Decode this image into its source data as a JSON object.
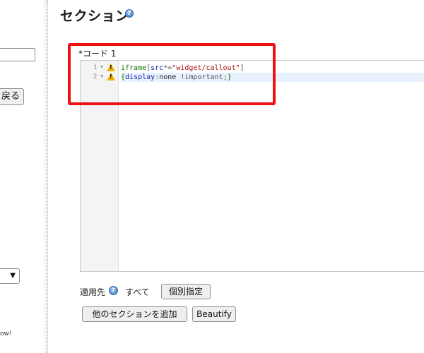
{
  "sidebar": {
    "back_label": "戻る",
    "footer_text": "ow!"
  },
  "section": {
    "title": "セクション",
    "help_icon": "question-circle-icon"
  },
  "editor": {
    "label": "*コード 1",
    "lines": [
      {
        "number": "1",
        "text": "iframe[src*=\"widget/callout\"]",
        "warning": true
      },
      {
        "number": "2",
        "text": "{display:none !important;}",
        "warning": true
      }
    ],
    "warning_icon": "warning-triangle-icon"
  },
  "apply": {
    "label": "適用先",
    "value": "すべて",
    "individual_button": "個別指定"
  },
  "actions": {
    "add_section": "他のセクションを追加",
    "beautify": "Beautify"
  },
  "colors": {
    "highlight_border": "#ee1111",
    "help_icon": "#3a78c4",
    "warning": "#f0b400",
    "active_line": "#e8f2ff"
  }
}
